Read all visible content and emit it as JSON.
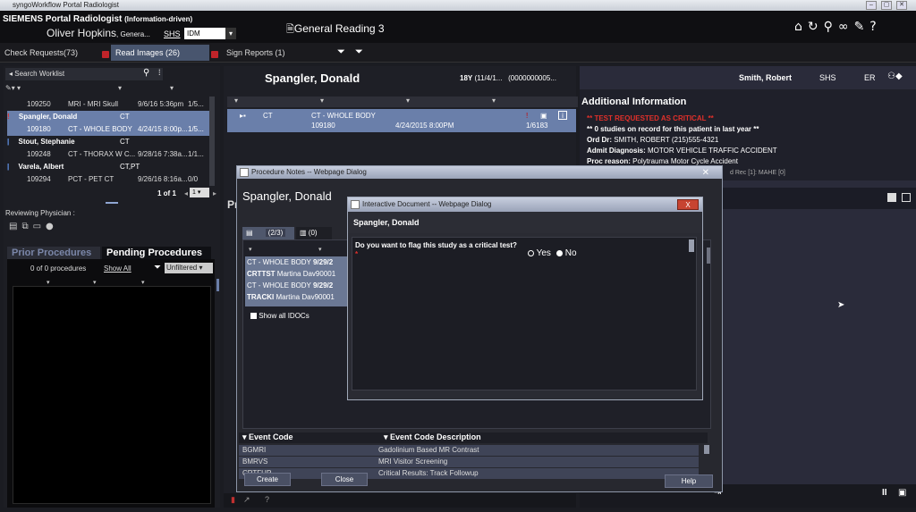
{
  "window": {
    "title": "syngoWorkflow Portal Radiologist"
  },
  "header": {
    "brand": "SIEMENS",
    "app_title": "Portal Radiologist",
    "mode": "(Information-driven)",
    "user_name": "Oliver Hopkins",
    "user_role": ", Genera...",
    "site": "SHS",
    "site_select": "IDM",
    "workspace_title": "General Reading 3"
  },
  "tabs": [
    {
      "label": "Check Requests",
      "count": "(73)"
    },
    {
      "label": "Read Images",
      "count": "(26)"
    },
    {
      "label": "Sign Reports",
      "count": "(1)"
    }
  ],
  "worklist": {
    "search_placeholder": "Search Worklist",
    "rows": [
      {
        "line1_a": "109250",
        "line1_b": "MRI - MRI Skull",
        "line1_c": "9/6/16 5:36pm",
        "line1_d": "1/5...",
        "name": "",
        "mod": ""
      },
      {
        "name": "Spangler, Donald",
        "mod": "CT",
        "line1_a": "109180",
        "line1_b": "CT - WHOLE BODY",
        "line1_c": "4/24/15 8:00p...",
        "line1_d": "1/5..."
      },
      {
        "name": "Stout, Stephanie",
        "mod": "CT",
        "line1_a": "109248",
        "line1_b": "CT - THORAX W C...",
        "line1_c": "9/28/16 7:38a...",
        "line1_d": "1/1..."
      },
      {
        "name": "Varela, Albert",
        "mod": "CT,PT",
        "line1_a": "109294",
        "line1_b": "PCT - PET CT",
        "line1_c": "9/26/16 8:16a...",
        "line1_d": "0/0"
      }
    ],
    "pager": "1 of 1",
    "page": "1"
  },
  "reviewing": {
    "label": "Reviewing Physician :"
  },
  "prior_tabs": {
    "prior": "Prior Procedures",
    "pending": "Pending Procedures"
  },
  "prior": {
    "count_text": "0 of 0 procedures",
    "show_all": "Show All",
    "filter": "Unfiltered"
  },
  "patient": {
    "name": "Spangler, Donald",
    "age": "18Y",
    "dob": "(11/4/1...",
    "id": "(0000000005...",
    "physician": "Smith, Robert",
    "site": "SHS",
    "dept": "ER"
  },
  "study": {
    "mod": "CT",
    "desc": "CT - WHOLE BODY",
    "acc": "109180",
    "date": "4/24/2015 8:00PM",
    "count": "1/6183"
  },
  "additional": {
    "title": "Additional Information",
    "critical": "** TEST REQUESTED AS CRITICAL **",
    "no_studies": "** 0 studies on record for this patient in last year **",
    "ord_dr_label": "Ord Dr:",
    "ord_dr": "SMITH, ROBERT  (215)555-4321",
    "admit_label": "Admit Diagnosis:",
    "admit": "MOTOR VEHICLE TRAFFIC ACCIDENT",
    "proc_label": "Proc reason:",
    "proc": "Polytrauma Motor Cycle Accident",
    "partial": "d Rec [1]: MAHE [0]"
  },
  "proc_dialog": {
    "title": "Procedure Notes -- Webpage Dialog",
    "patient": "Spangler, Donald",
    "tab1": "(2/3)",
    "tab2": "(0)",
    "list": [
      {
        "a": "CT - WHOLE BODY",
        "b": "9/29/2"
      },
      {
        "a": "CRTTST",
        "b": "Martina Dav90001"
      },
      {
        "a": "CT - WHOLE BODY",
        "b": "9/29/2"
      },
      {
        "a": "TRACKI",
        "b": "Martina Dav90001"
      }
    ],
    "show_all": "Show all IDOCs",
    "col1": "Event Code",
    "col2": "Event Code Description",
    "events": [
      {
        "code": "BGMRI",
        "desc": "Gadolinium Based MR Contrast"
      },
      {
        "code": "BMRVS",
        "desc": "MRI Visitor Screening"
      },
      {
        "code": "CRTFUP",
        "desc": "Critical Results: Track Followup"
      }
    ],
    "create": "Create",
    "close": "Close",
    "help": "Help",
    "side_label": "Pr"
  },
  "interactive_dialog": {
    "title": "Interactive Document -- Webpage Dialog",
    "patient": "Spangler, Donald",
    "question": "Do you want to flag this study as a critical test?",
    "required": "*",
    "yes": "Yes",
    "no": "No",
    "close_glyph": "X"
  },
  "colors": {
    "accent": "#48556e",
    "critical": "#e0302a",
    "selection": "#6a7faa"
  }
}
